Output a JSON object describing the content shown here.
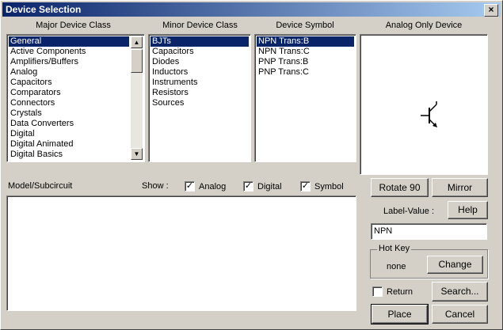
{
  "window": {
    "title": "Device Selection",
    "close_glyph": "×"
  },
  "columns": {
    "major": "Major Device Class",
    "minor": "Minor Device Class",
    "symbol": "Device Symbol",
    "preview": "Analog Only Device"
  },
  "major_list": [
    "General",
    "Active Components",
    "Amplifiers/Buffers",
    "Analog",
    "Capacitors",
    "Comparators",
    "Connectors",
    "Crystals",
    "Data Converters",
    "Digital",
    "Digital Animated",
    "Digital Basics"
  ],
  "minor_list": [
    "BJTs",
    "Capacitors",
    "Diodes",
    "Inductors",
    "Instruments",
    "Resistors",
    "Sources"
  ],
  "symbol_list": [
    "NPN Trans:B",
    "NPN Trans:C",
    "PNP Trans:B",
    "PNP Trans:C"
  ],
  "model": {
    "label": "Model/Subcircuit"
  },
  "show": {
    "label": "Show :",
    "analog": "Analog",
    "digital": "Digital",
    "symbol": "Symbol"
  },
  "buttons": {
    "rotate": "Rotate 90",
    "mirror": "Mirror",
    "help": "Help",
    "change": "Change",
    "search": "Search...",
    "place": "Place",
    "cancel": "Cancel"
  },
  "label_value": {
    "label": "Label-Value :",
    "value": "NPN"
  },
  "hotkey": {
    "group": "Hot Key",
    "value": "none"
  },
  "return_label": "Return",
  "checks": {
    "analog": true,
    "digital": true,
    "symbol": true,
    "return": false
  },
  "check_glyph": "✓",
  "colors": {
    "selection": "#0a246a",
    "face": "#d4d0c8"
  }
}
